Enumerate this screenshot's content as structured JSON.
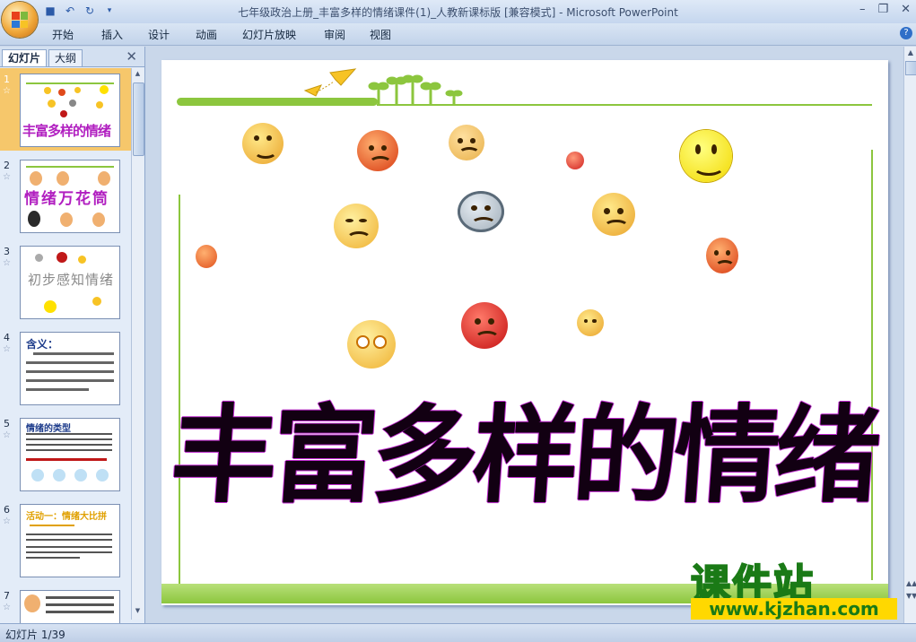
{
  "window": {
    "title": "七年级政治上册_丰富多样的情绪课件(1)_人教新课标版 [兼容模式] - Microsoft PowerPoint"
  },
  "quick_access": {
    "icons": [
      "save-icon",
      "undo-icon",
      "redo-icon",
      "customize-icon"
    ]
  },
  "ribbon": {
    "tabs": [
      "开始",
      "插入",
      "设计",
      "动画",
      "幻灯片放映",
      "审阅",
      "视图"
    ]
  },
  "panel": {
    "tab_slides": "幻灯片",
    "tab_outline": "大纲",
    "slides": [
      {
        "number": "1",
        "label": "丰富多样的情绪"
      },
      {
        "number": "2",
        "label": "情绪万花筒"
      },
      {
        "number": "3",
        "label": "初步感知情绪"
      },
      {
        "number": "4",
        "label": "含义："
      },
      {
        "number": "5",
        "label": "情绪的类型"
      },
      {
        "number": "6",
        "label": "活动一：情绪大比拼"
      },
      {
        "number": "7",
        "label": ""
      }
    ]
  },
  "slide": {
    "title": "丰富多样的情绪",
    "colors": {
      "line": "#8cc63e",
      "title": "#120012",
      "outline": "#c02ad0"
    }
  },
  "watermark": {
    "text_cn": "课件站",
    "url": "www.kjzhan.com",
    "colors": {
      "fill": "#ffd800",
      "stroke": "#1a7a16"
    }
  },
  "status": {
    "slide_indicator": "幻灯片 1/39"
  }
}
